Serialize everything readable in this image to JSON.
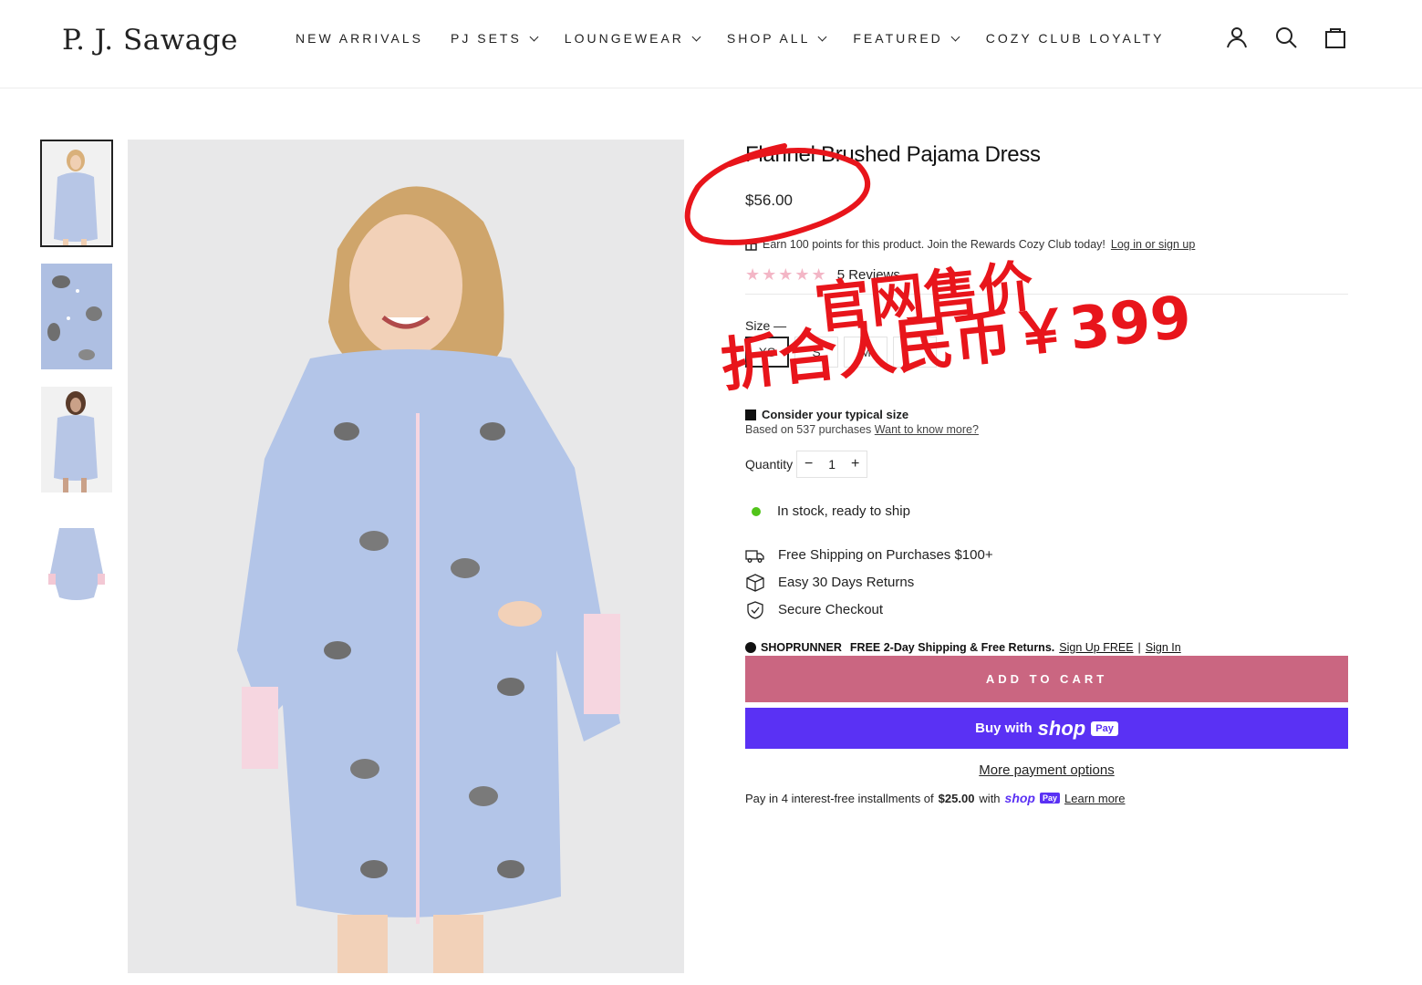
{
  "brand": "P. J. Sawage",
  "nav": [
    {
      "label": "NEW ARRIVALS",
      "dropdown": false
    },
    {
      "label": "PJ SETS",
      "dropdown": true
    },
    {
      "label": "LOUNGEWEAR",
      "dropdown": true
    },
    {
      "label": "SHOP ALL",
      "dropdown": true
    },
    {
      "label": "FEATURED",
      "dropdown": true
    },
    {
      "label": "COZY CLUB LOYALTY",
      "dropdown": false
    }
  ],
  "header_icons": [
    "account-icon",
    "search-icon",
    "cart-icon"
  ],
  "product": {
    "title": "Flannel Brushed Pajama Dress",
    "price": "$56.00",
    "rewards_text": "Earn 100 points for this product. Join the Rewards Cozy Club today!",
    "rewards_link": "Log in or sign up",
    "rating": 4.5,
    "reviews_label": "5 Reviews",
    "size_label": "Size —",
    "sizes": [
      "XS",
      "S",
      "M",
      ""
    ],
    "selected_size": "XS",
    "fit_title": "Consider your typical size",
    "fit_sub": "Based on 537 purchases",
    "fit_link": "Want to know more?",
    "quantity_label": "Quantity",
    "quantity": "1",
    "stock_text": "In stock, ready to ship",
    "perks": [
      {
        "icon": "truck-icon",
        "text": "Free Shipping on Purchases $100+"
      },
      {
        "icon": "box-icon",
        "text": "Easy 30 Days Returns"
      },
      {
        "icon": "shield-icon",
        "text": "Secure Checkout"
      }
    ],
    "shoprunner": {
      "brand": "SHOPRUNNER",
      "text": "FREE 2-Day Shipping & Free Returns.",
      "signup": "Sign Up FREE",
      "separator": "|",
      "signin": "Sign In"
    },
    "add_to_cart": "ADD TO CART",
    "shop_pay": {
      "prefix": "Buy with",
      "shop": "shop",
      "pay": "Pay"
    },
    "more_payment": "More payment options",
    "installments": {
      "prefix": "Pay in 4 interest-free installments of",
      "amount": "$25.00",
      "with": "with",
      "shop": "shop",
      "pay": "Pay",
      "link": "Learn more"
    }
  },
  "annotation": {
    "line1": "官网售价",
    "line2": "折合人民币￥399",
    "color": "#e8151b"
  },
  "colors": {
    "add_to_cart": "#ca6681",
    "shop_pay": "#5a31f4",
    "stock_dot": "#52c41a",
    "stars": "#f3b6c6"
  }
}
